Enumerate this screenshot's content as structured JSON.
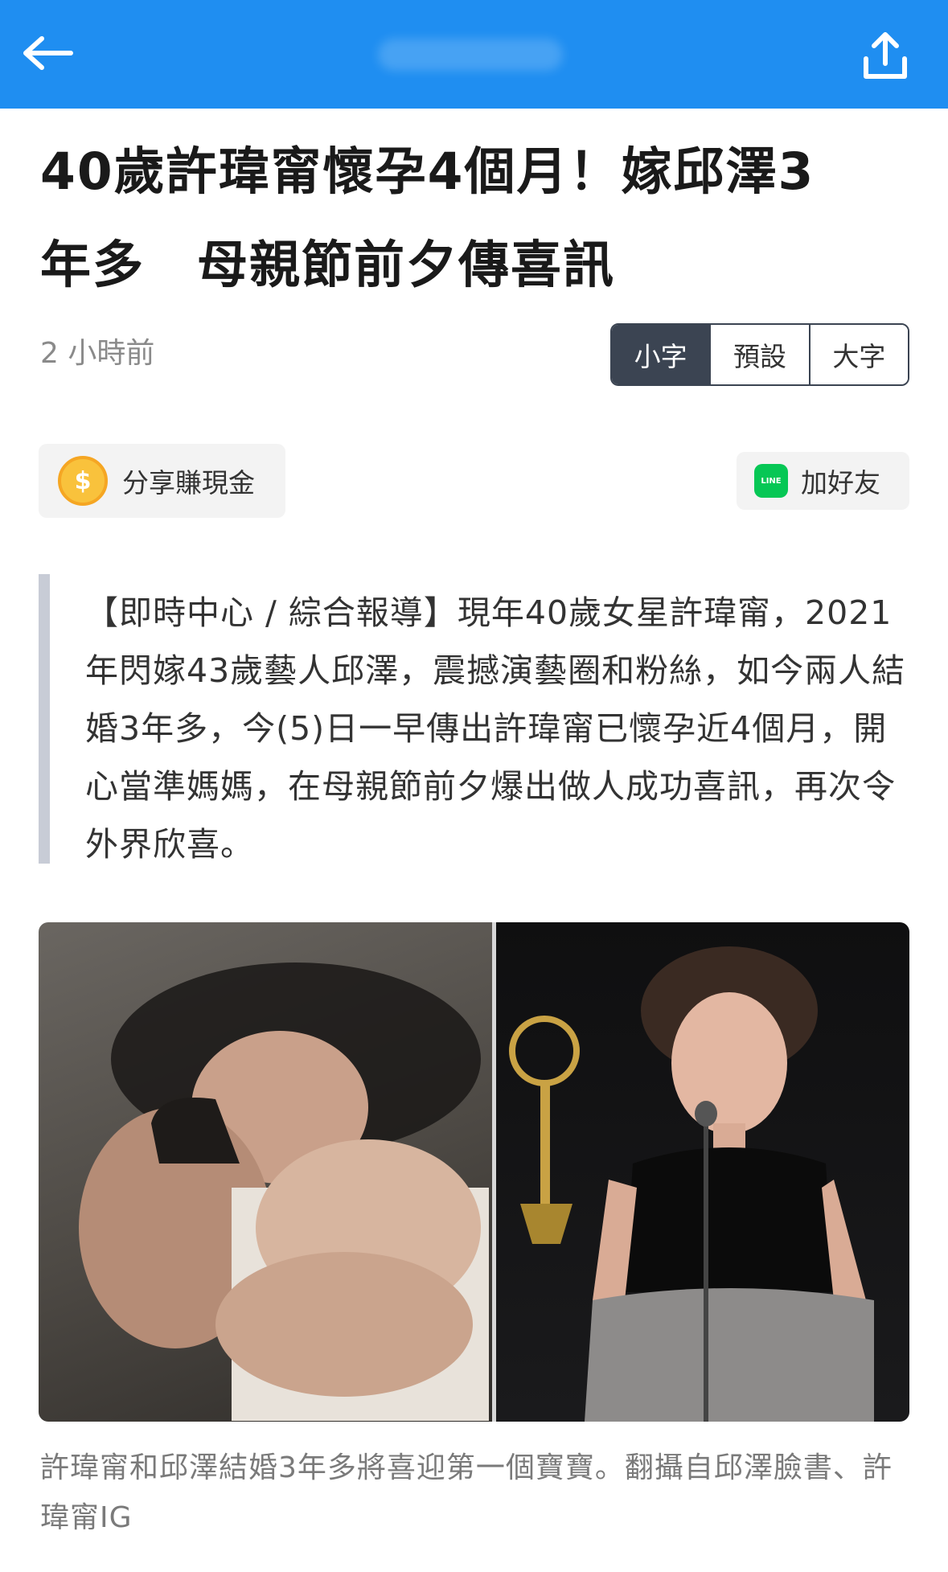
{
  "header": {
    "back_icon": "arrow-left-icon",
    "share_icon": "share-upload-icon",
    "brand_color": "#1f8ef1"
  },
  "article": {
    "title": "40歲許瑋甯懷孕4個月！嫁邱澤3\n年多　母親節前夕傳喜訊",
    "time": "2 小時前",
    "lead": "【即時中心 / 綜合報導】現年40歲女星許瑋甯，2021年閃嫁43歲藝人邱澤，震撼演藝圈和粉絲，如今兩人結婚3年多，今(5)日一早傳出許瑋甯已懷孕近4個月，開心當準媽媽，在母親節前夕爆出做人成功喜訊，再次令外界欣喜。",
    "image_caption": "許瑋甯和邱澤結婚3年多將喜迎第一個寶寶。翻攝自邱澤臉書、許瑋甯IG"
  },
  "font_size_toggle": {
    "small": "小字",
    "default": "預設",
    "large": "大字",
    "selected": "small"
  },
  "actions": {
    "earn_label": "分享賺現金",
    "earn_icon": "coin-icon",
    "coin_symbol": "$",
    "add_friend_label": "加好友",
    "line_icon": "line-icon",
    "line_text": "LINE"
  }
}
